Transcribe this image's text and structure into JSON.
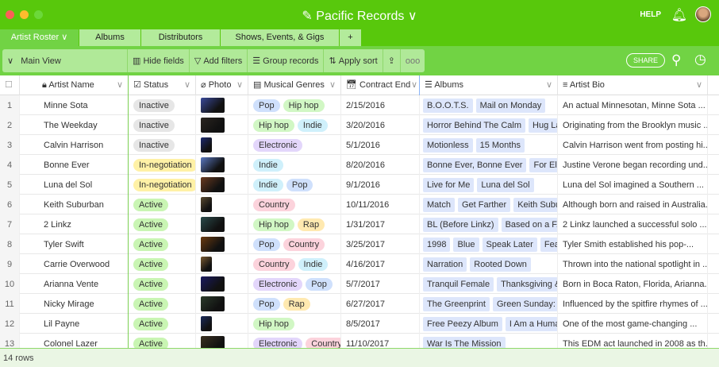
{
  "app": {
    "title": "Pacific Records",
    "help": "HELP"
  },
  "tabs": [
    {
      "label": "Artist Roster ∨",
      "active": true
    },
    {
      "label": "Albums"
    },
    {
      "label": "Distributors"
    },
    {
      "label": "Shows, Events, & Gigs"
    },
    {
      "label": "+"
    }
  ],
  "toolbar": {
    "view": "Main View",
    "hide": "Hide fields",
    "filter": "Add filters",
    "group": "Group records",
    "sort": "Apply sort",
    "share": "SHARE"
  },
  "columns": [
    "Artist Name",
    "Status",
    "Photo",
    "Musical Genres",
    "Contract End",
    "Albums",
    "Artist Bio"
  ],
  "colors": {
    "brand": "#58c80c",
    "Pop": "#cfe0fc",
    "Hip hop": "#d1f7c4",
    "Indie": "#cff0fb",
    "Electronic": "#e3d6fb",
    "Country": "#fcd3dc",
    "Rap": "#ffe9b0",
    "Inactive": "#e6e6e6",
    "In-negotiation": "#fff1a6",
    "Active": "#c9f5b3"
  },
  "rows": [
    {
      "n": "1",
      "name": "Minne Sota",
      "status": "Inactive",
      "genres": [
        "Pop",
        "Hip hop"
      ],
      "date": "2/15/2016",
      "albums": [
        "B.O.O.T.S.",
        "Mail on Monday"
      ],
      "bio": "An actual Minnesotan, Minne Sota ...",
      "photo": "#3a4a9a"
    },
    {
      "n": "2",
      "name": "The Weekday",
      "status": "Inactive",
      "genres": [
        "Hip hop",
        "Indie"
      ],
      "date": "3/20/2016",
      "albums": [
        "Horror Behind The Calm",
        "Hug Land"
      ],
      "bio": "Originating from the Brooklyn music ...",
      "photo": "#2a2520"
    },
    {
      "n": "3",
      "name": "Calvin Harrison",
      "status": "Inactive",
      "genres": [
        "Electronic"
      ],
      "date": "5/1/2016",
      "albums": [
        "Motionless",
        "15 Months"
      ],
      "bio": "Calvin Harrison went from posting hi...",
      "photo": "#1d2a70"
    },
    {
      "n": "4",
      "name": "Bonne Ever",
      "status": "In-negotiation",
      "genres": [
        "Indie"
      ],
      "date": "8/20/2016",
      "albums": [
        "Bonne Ever, Bonne Ever",
        "For Ella, F"
      ],
      "bio": "Justine Verone began recording und...",
      "photo": "#5a78c0"
    },
    {
      "n": "5",
      "name": "Luna del Sol",
      "status": "In-negotiation",
      "genres": [
        "Indie",
        "Pop"
      ],
      "date": "9/1/2016",
      "albums": [
        "Live for Me",
        "Luna del Sol"
      ],
      "bio": "Luna del Sol imagined a Southern ...",
      "photo": "#6a3a20"
    },
    {
      "n": "6",
      "name": "Keith Suburban",
      "status": "Active",
      "genres": [
        "Country"
      ],
      "date": "10/11/2016",
      "albums": [
        "Match",
        "Get Farther",
        "Keith Suburba"
      ],
      "bio": "Although born and raised in Australia...",
      "photo": "#5a4a30"
    },
    {
      "n": "7",
      "name": "2 Linkz",
      "status": "Active",
      "genres": [
        "Hip hop",
        "Rap"
      ],
      "date": "1/31/2017",
      "albums": [
        "BL (Before Linkz)",
        "Based on a F.A.L"
      ],
      "bio": "2 Linkz launched a successful solo ...",
      "photo": "#2a4a4a"
    },
    {
      "n": "8",
      "name": "Tyler Swift",
      "status": "Active",
      "genres": [
        "Pop",
        "Country"
      ],
      "date": "3/25/2017",
      "albums": [
        "1998",
        "Blue",
        "Speak Later",
        "Fearful"
      ],
      "bio": "Tyler Smith established his pop-...",
      "photo": "#6a3a10"
    },
    {
      "n": "9",
      "name": "Carrie Overwood",
      "status": "Active",
      "genres": [
        "Country",
        "Indie"
      ],
      "date": "4/16/2017",
      "albums": [
        "Narration",
        "Rooted Down"
      ],
      "bio": "Thrown into the national spotlight in ...",
      "photo": "#7a5a30"
    },
    {
      "n": "10",
      "name": "Arianna Vente",
      "status": "Active",
      "genres": [
        "Electronic",
        "Pop"
      ],
      "date": "5/7/2017",
      "albums": [
        "Tranquil Female",
        "Thanksgiving & Ch"
      ],
      "bio": "Born in Boca Raton, Florida, Arianna...",
      "photo": "#1a1a60"
    },
    {
      "n": "11",
      "name": "Nicky Mirage",
      "status": "Active",
      "genres": [
        "Pop",
        "Rap"
      ],
      "date": "6/27/2017",
      "albums": [
        "The Greenprint",
        "Green Sunday: Rel"
      ],
      "bio": "Influenced by the spitfire rhymes of ...",
      "photo": "#2a3a2a"
    },
    {
      "n": "12",
      "name": "Lil Payne",
      "status": "Active",
      "genres": [
        "Hip hop"
      ],
      "date": "8/5/2017",
      "albums": [
        "Free Peezy Album",
        "I Am a Human B"
      ],
      "bio": "One of the most game-changing ...",
      "photo": "#1a2a5a"
    },
    {
      "n": "13",
      "name": "Colonel Lazer",
      "status": "Active",
      "genres": [
        "Electronic",
        "Country"
      ],
      "date": "11/10/2017",
      "albums": [
        "War Is The Mission"
      ],
      "bio": "This EDM act launched in 2008 as th...",
      "photo": "#3a3020"
    }
  ],
  "footer": "14 rows"
}
